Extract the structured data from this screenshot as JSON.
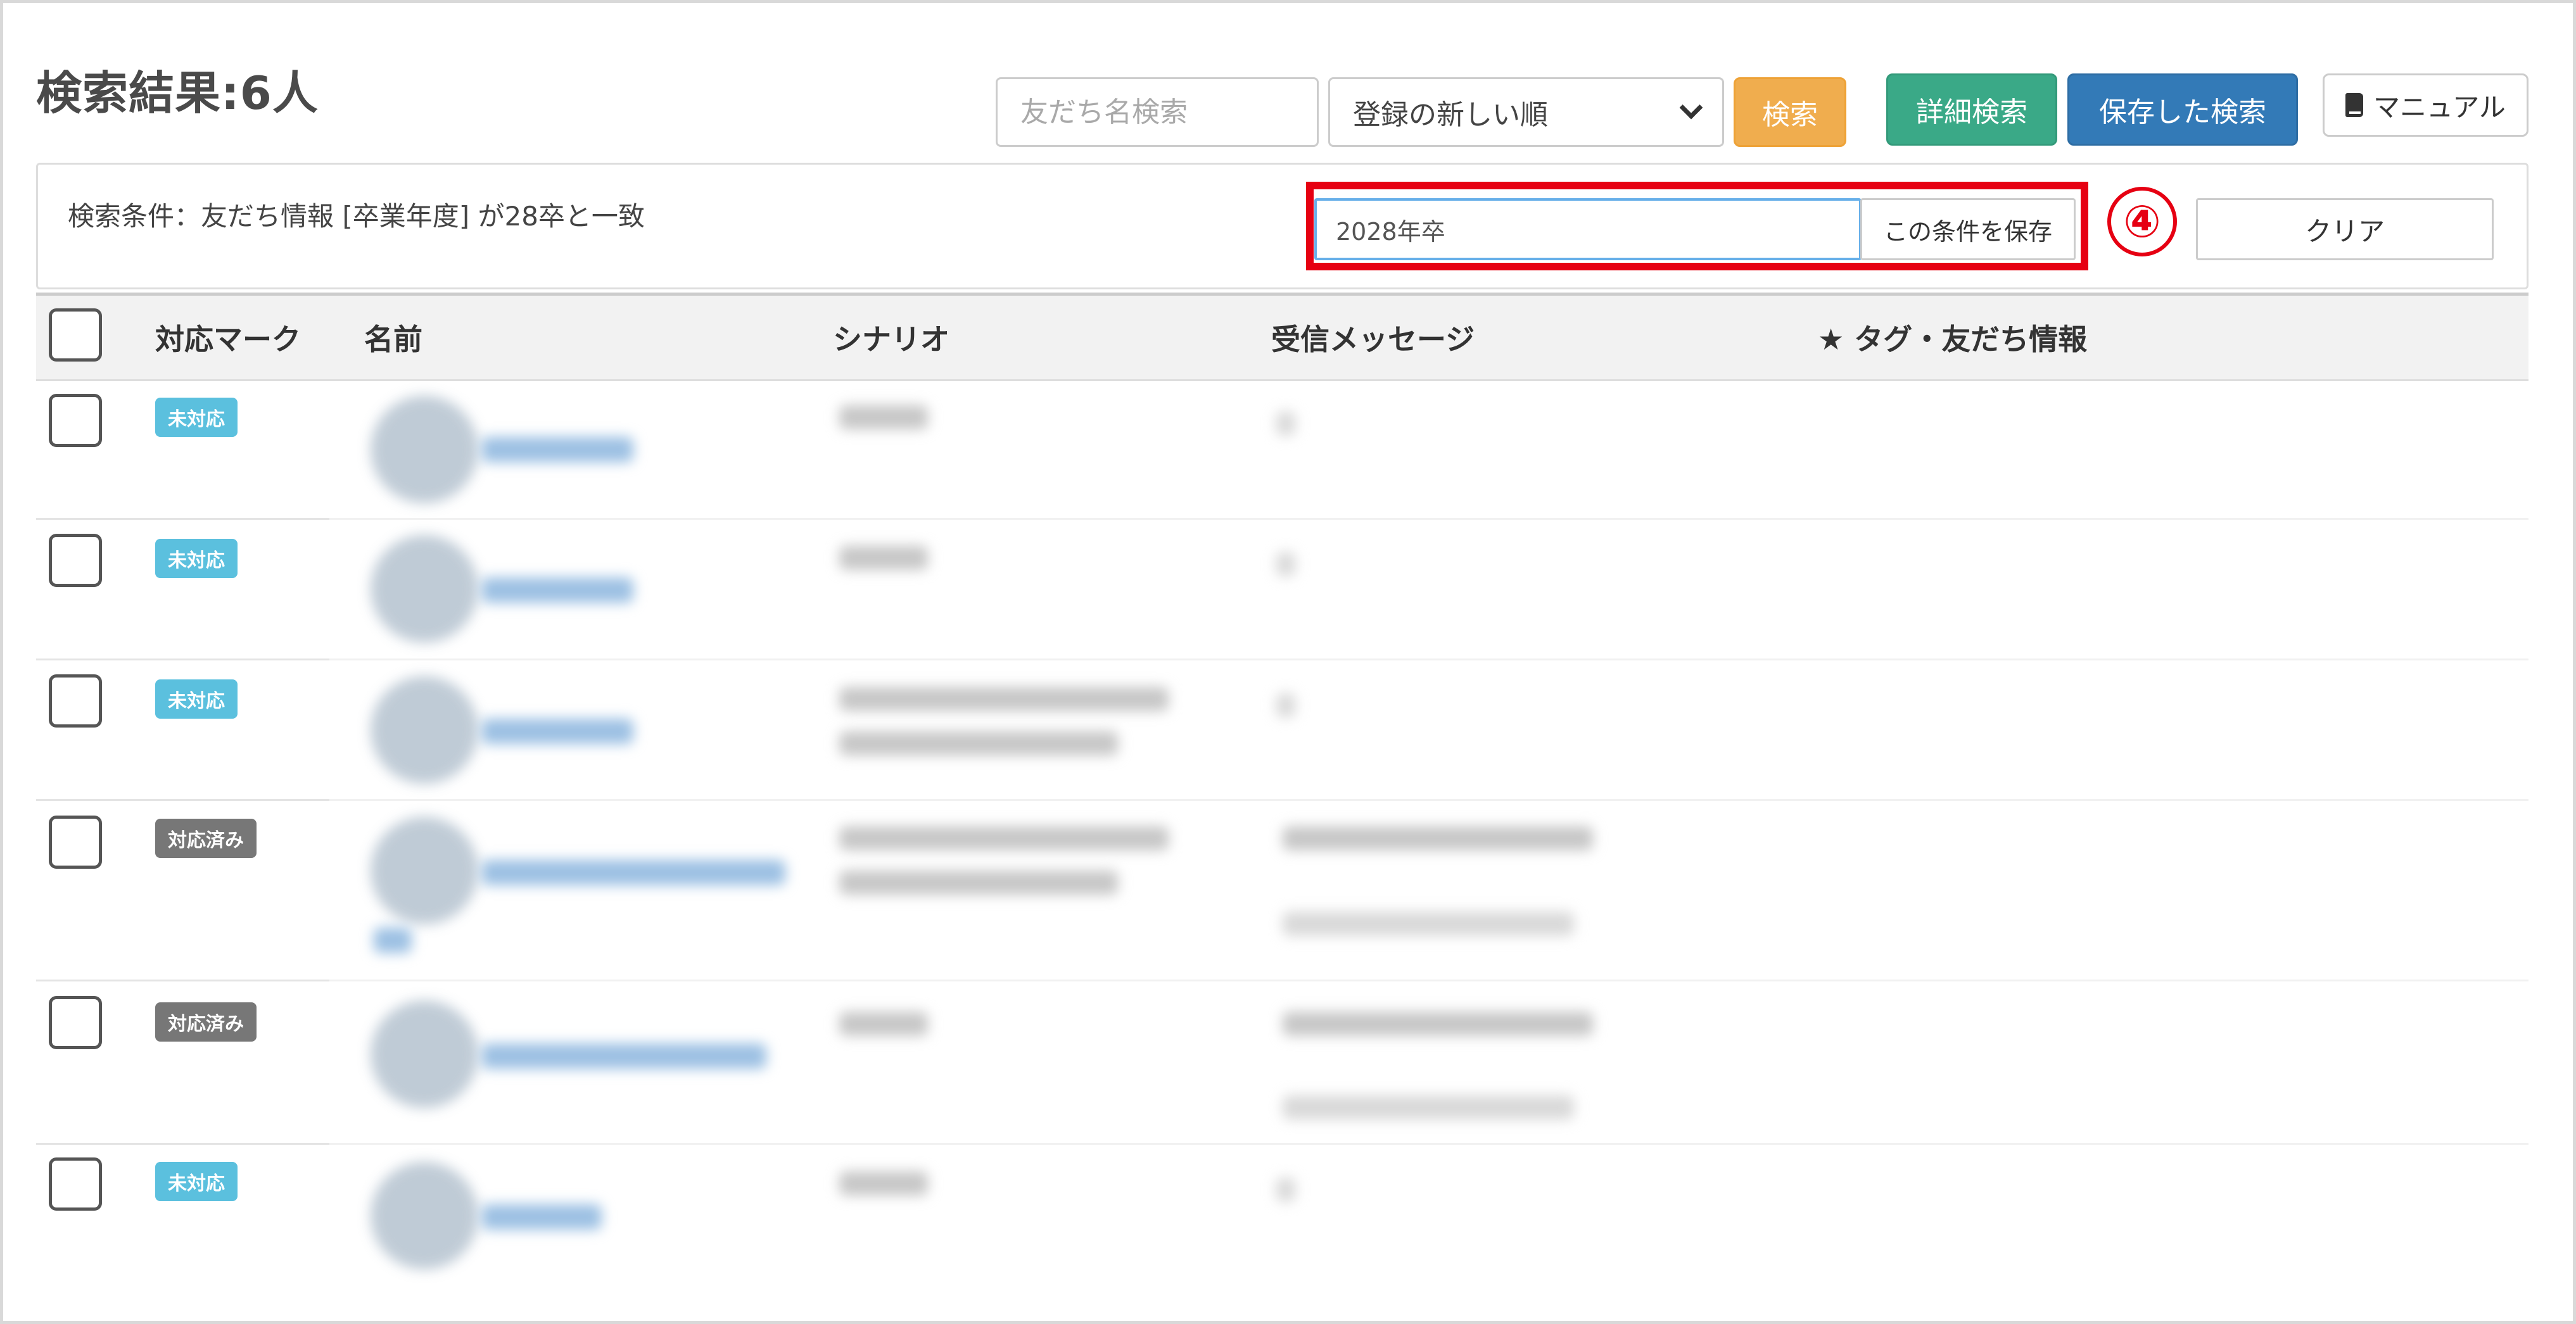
{
  "header": {
    "title": "検索結果:6人",
    "name_search_placeholder": "友だち名検索",
    "sort_selected": "登録の新しい順",
    "search_label": "検索",
    "detail_search_label": "詳細検索",
    "saved_search_label": "保存した検索",
    "manual_label": "マニュアル"
  },
  "condition": {
    "text": "検索条件：友だち情報 [卒業年度] が28卒と一致",
    "save_name_value": "2028年卒",
    "save_label": "この条件を保存",
    "clear_label": "クリア",
    "step_number": "④"
  },
  "table": {
    "columns": [
      "対応マーク",
      "名前",
      "シナリオ",
      "受信メッセージ",
      "★ タグ・友だち情報"
    ],
    "rows": [
      {
        "status": "未対応"
      },
      {
        "status": "未対応"
      },
      {
        "status": "未対応"
      },
      {
        "status": "対応済み"
      },
      {
        "status": "対応済み"
      },
      {
        "status": "未対応"
      }
    ]
  },
  "colors": {
    "badge_open": "#5bc0de",
    "badge_done": "#777777",
    "highlight": "#e60012",
    "detail_button": "#3aa987",
    "saved_button": "#337ab7",
    "search_button": "#f0ad4e"
  }
}
